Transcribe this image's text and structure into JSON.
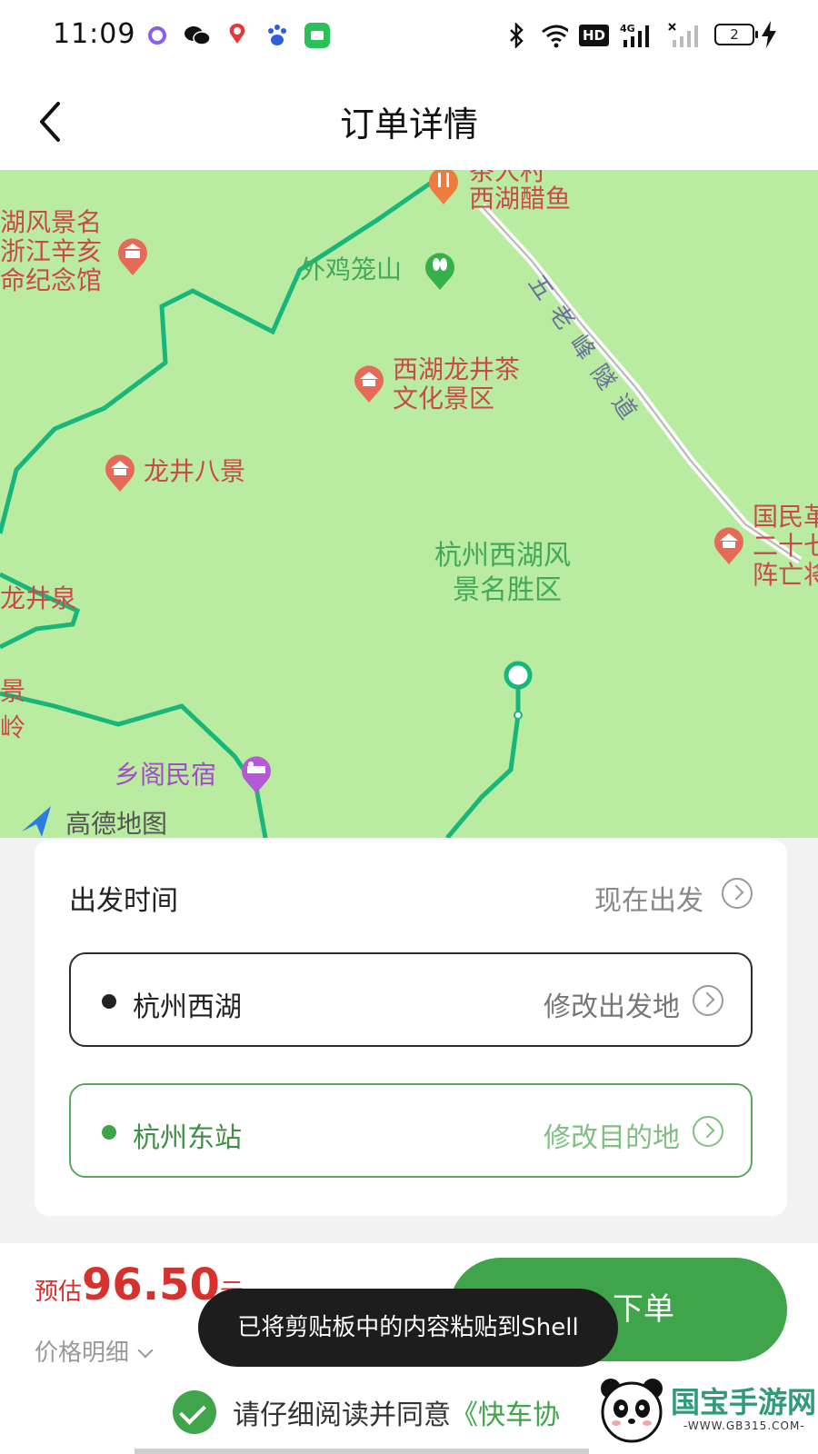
{
  "status_bar": {
    "time": "11:09",
    "network": "4G",
    "hd": "HD",
    "battery": "2"
  },
  "header": {
    "title": "订单详情"
  },
  "map": {
    "labels": {
      "restaurant_top": "西湖醋鱼",
      "restaurant_top_cut": "茶人村",
      "memorial_l1": "湖风景名",
      "memorial_l2": "浙江辛亥",
      "memorial_l3": "命纪念馆",
      "waiji": "外鸡笼山",
      "longjing_tea_l1": "西湖龙井茶",
      "longjing_tea_l2": "文化景区",
      "longjing_8": "龙井八景",
      "west_lake_l1": "杭州西湖风",
      "west_lake_l2": "景名胜区",
      "longjingquan": "龙井泉",
      "scenic_l1": "景",
      "scenic_l2": "岭",
      "homestay": "乡阁民宿",
      "tunnel": "五老峰隧道",
      "right_l1": "国民革",
      "right_l2": "二十七",
      "right_l3": "阵亡将",
      "map_brand": "高德地图"
    }
  },
  "order": {
    "departure_label": "出发时间",
    "departure_value": "现在出发",
    "origin_name": "杭州西湖",
    "origin_action": "修改出发地",
    "dest_name": "杭州东站",
    "dest_action": "修改目的地"
  },
  "price": {
    "estimate_label": "预估",
    "amount": "96.50",
    "unit": "元",
    "detail_label": "价格明细"
  },
  "submit": {
    "label": "下单"
  },
  "agreement": {
    "text": "请仔细阅读并同意",
    "link": "《快车协"
  },
  "toast": {
    "message": "已将剪贴板中的内容粘贴到Shell"
  },
  "watermark": {
    "text": "国宝手游网",
    "url": "-WWW.GB315.COM-"
  },
  "colors": {
    "accent": "#3fa44a",
    "price": "#d8312d",
    "map_bg": "#b9eca0",
    "route": "#18b37a"
  }
}
